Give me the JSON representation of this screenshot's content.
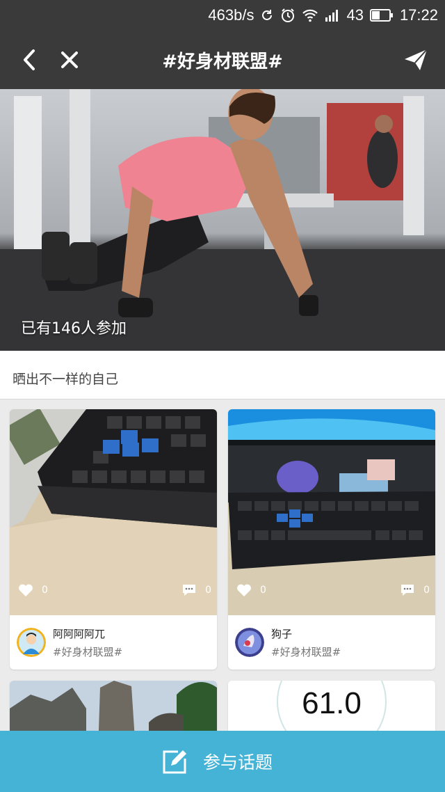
{
  "status_bar": {
    "net_speed": "463b/s",
    "battery": "43",
    "time": "17:22"
  },
  "nav": {
    "title": "#好身材联盟#"
  },
  "hero": {
    "participants": "已有146人参加"
  },
  "subtitle": "晒出不一样的自己",
  "posts": [
    {
      "author": "阿阿阿阿兀",
      "tag": "#好身材联盟#",
      "likes": "0",
      "comments": "0"
    },
    {
      "author": "狗子",
      "tag": "#好身材联盟#",
      "likes": "0",
      "comments": "0"
    },
    {
      "scale_reading": "61.0"
    }
  ],
  "bottom": {
    "join_label": "参与话题"
  },
  "colors": {
    "top_bar": "#3a3a3a",
    "action_bar": "#45b3d6"
  }
}
